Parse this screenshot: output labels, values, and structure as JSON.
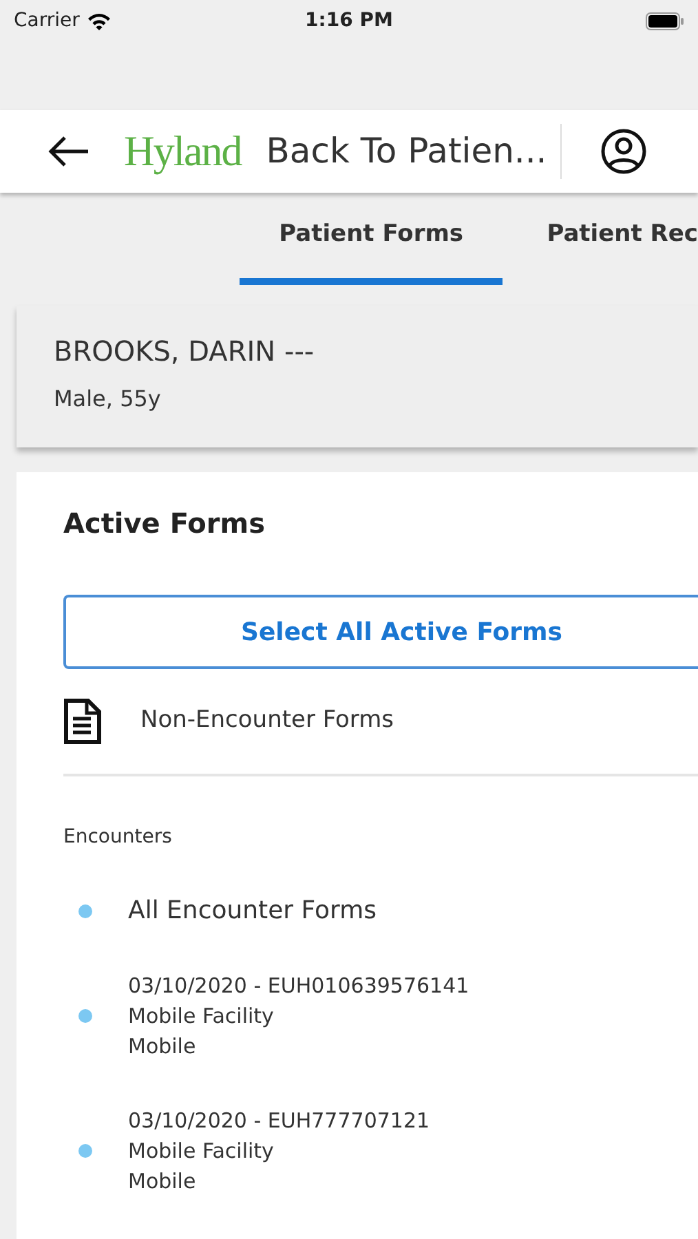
{
  "status_bar": {
    "carrier": "Carrier",
    "time": "1:16 PM"
  },
  "header": {
    "logo": "Hyland",
    "title": "Back To Patien..."
  },
  "tabs": [
    {
      "label": "Patient Forms",
      "selected": true
    },
    {
      "label": "Patient Rec",
      "selected": false
    }
  ],
  "patient": {
    "name": "BROOKS, DARIN ---",
    "details": "Male, 55y"
  },
  "active_forms": {
    "heading": "Active Forms",
    "select_all_button": "Select All Active Forms",
    "non_encounter": "Non-Encounter Forms"
  },
  "encounters": {
    "heading": "Encounters",
    "items": [
      {
        "lines": [
          "All Encounter Forms"
        ]
      },
      {
        "lines": [
          "03/10/2020 - EUH010639576141",
          "Mobile Facility",
          "Mobile"
        ]
      },
      {
        "lines": [
          "03/10/2020 - EUH777707121",
          "Mobile Facility",
          "Mobile"
        ]
      }
    ]
  }
}
